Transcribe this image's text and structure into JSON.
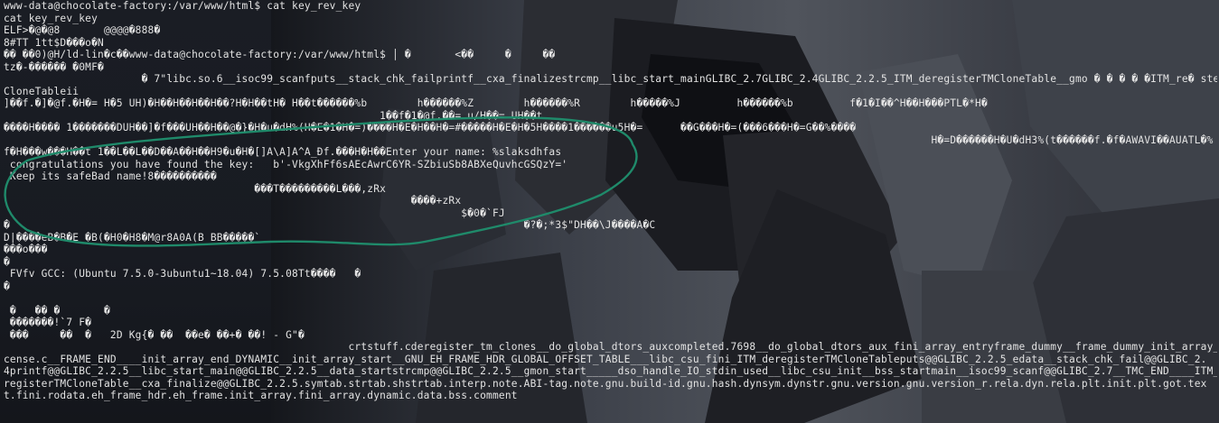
{
  "terminal": {
    "prompt": "www-data@chocolate-factory:/var/www/html$",
    "command": "cat key_rev_key",
    "lines": [
      "www-data@chocolate-factory:/var/www/html$ cat key_rev_key",
      "cat key_rev_key",
      "ELF>�@�@8       @@@@�888�",
      "8#TT 1tt$D���o�N",
      "�� ��0)@H/ld-lin�c��www-data@chocolate-factory:/var/www/html$ │ �       <��     �     ��",
      "tz�-������ �0MF�",
      "                      � 7\"libc.so.6__isoc99_scanfputs__stack_chk_failprintf__cxa_finalizestrcmp__libc_start_mainGLIBC_2.7GLIBC_2.4GLIBC_2.2.5_ITM_deregisterTMCloneTable__gmo � � � � �ITM_re� sterTM",
      "CloneTableii",
      "]��f.�]�@f.�H�= H�5 UH)�H��H��H��H��?H�H��tH� H��t������%b        h������%Z        h������%R        h�����%J         h������%b         f�1�I��^H��H���PTL�*H�",
      "                                                            1��f�1�@f.��= u/H��= UH��t",
      "����H���� 1�������DUH��]�f���UH��H��@�}�H�u�dH%(H�E�1�H�=)����H�E�H��H�=#�����H�E�H�5H����1������u5H�=      ��G���H�=(���6���H�=G��%����",
      "                                                                                                                                                    H�=D������H�U�dH3%(t������f.�f�AWAVI��AUATL�% UH�- SA��I��L)",
      "f�H���w���H��t 1��L��L��D��A��H��H9�u�H�[]A\\A]A^A_Ðf.���H�H��Enter your name: %slaksdhfas",
      " congratulations you have found the key:   b'-VkgXhFf6sAEcAwrC6YR-SZbiuSb8ABXeQuvhcGSQzY='",
      " Keep its safeBad name!8����������",
      "                                        ���T���������L���,zRx",
      "                                                                 ����+zRx",
      "                                                                         $�0�`FJ",
      "�                                                                                  �?�;*3$\"DH��\\J����A�C",
      "D|����eB�B�E �B(�H0�H8�M@r8A0A(B BB�����`",
      "���o���",
      "�",
      " FVfv GCC: (Ubuntu 7.5.0-3ubuntu1~18.04) 7.5.08Tt����   �",
      "�",
      "",
      " �   �� �       �",
      " �������!`7 F�",
      " ���     ��  �   2D Kg{� ��  ��e� ��+� ��! - G\"�",
      "                                                       crtstuff.cderegister_tm_clones__do_global_dtors_auxcompleted.7698__do_global_dtors_aux_fini_array_entryframe_dummy__frame_dummy_init_array_entryli",
      "cense.c__FRAME_END____init_array_end_DYNAMIC__init_array_start__GNU_EH_FRAME_HDR_GLOBAL_OFFSET_TABLE___libc_csu_fini_ITM_deregisterTMCloneTableputs@@GLIBC_2.2.5_edata__stack_chk_fail@@GLIBC_2.",
      "4printf@@GLIBC_2.2.5__libc_start_main@@GLIBC_2.2.5__data_startstrcmp@@GLIBC_2.2.5__gmon_start_____dso_handle_IO_stdin_used__libc_csu_init__bss_startmain__isoc99_scanf@@GLIBC_2.7__TMC_END____ITM_",
      "registerTMCloneTable__cxa_finalize@@GLIBC_2.2.5.symtab.strtab.shstrtab.interp.note.ABI-tag.note.gnu.build-id.gnu.hash.dynsym.dynstr.gnu.version.gnu.version_r.rela.dyn.rela.plt.init.plt.got.tex",
      "t.fini.rodata.eh_frame_hdr.eh_frame.init_array.fini_array.dynamic.data.bss.comment"
    ]
  },
  "colors": {
    "text": "#e3e3e3",
    "annotation_stroke": "#1f8a6a"
  }
}
